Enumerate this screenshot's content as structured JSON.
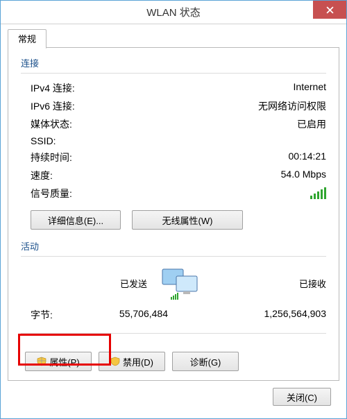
{
  "window": {
    "title": "WLAN 状态"
  },
  "tabs": {
    "general": "常规"
  },
  "connection": {
    "group_label": "连接",
    "ipv4_label": "IPv4 连接:",
    "ipv4_value": "Internet",
    "ipv6_label": "IPv6 连接:",
    "ipv6_value": "无网络访问权限",
    "media_label": "媒体状态:",
    "media_value": "已启用",
    "ssid_label": "SSID:",
    "ssid_value": "",
    "duration_label": "持续时间:",
    "duration_value": "00:14:21",
    "speed_label": "速度:",
    "speed_value": "54.0 Mbps",
    "signal_label": "信号质量:"
  },
  "buttons": {
    "details": "详细信息(E)...",
    "wireless_props": "无线属性(W)",
    "properties": "属性(P)",
    "disable": "禁用(D)",
    "diagnose": "诊断(G)",
    "close": "关闭(C)"
  },
  "activity": {
    "group_label": "活动",
    "sent_label": "已发送",
    "recv_label": "已接收",
    "bytes_label": "字节:",
    "sent_value": "55,706,484",
    "recv_value": "1,256,564,903"
  },
  "icons": {
    "close": "close-icon",
    "shield": "shield-icon",
    "signal": "signal-bars-icon",
    "netactivity": "network-activity-icon"
  }
}
